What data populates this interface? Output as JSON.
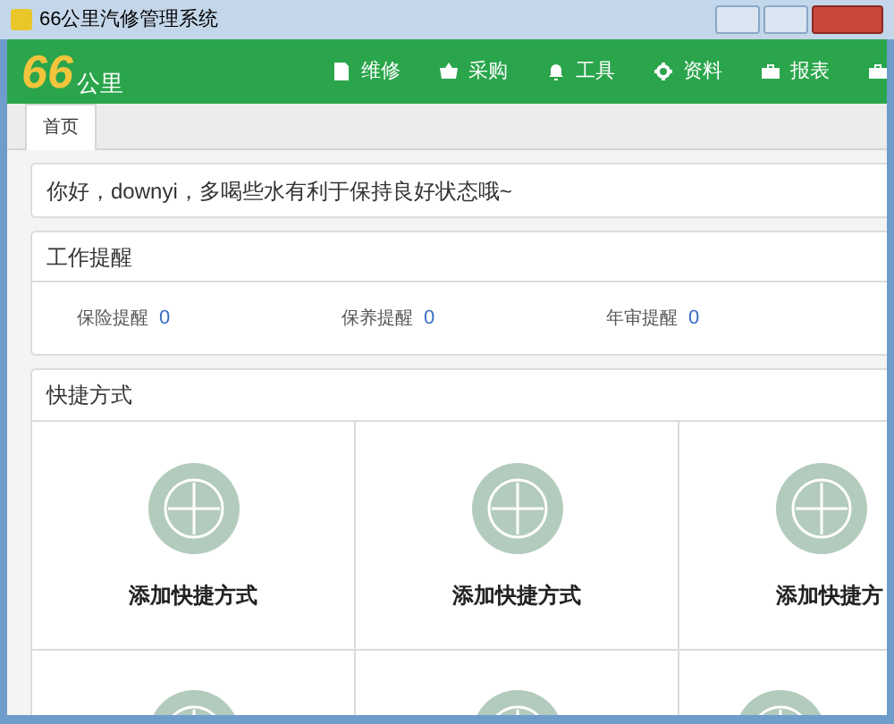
{
  "window": {
    "title": "66公里汽修管理系统"
  },
  "logo": {
    "number": "66",
    "text": "公里"
  },
  "nav": [
    {
      "label": "维修",
      "kind": "doc"
    },
    {
      "label": "采购",
      "kind": "basket"
    },
    {
      "label": "工具",
      "kind": "bell"
    },
    {
      "label": "资料",
      "kind": "gear"
    },
    {
      "label": "报表",
      "kind": "case"
    },
    {
      "kind": "case"
    }
  ],
  "tabs": [
    {
      "label": "首页",
      "selected": true
    }
  ],
  "greeting": "你好，downyi，多喝些水有利于保持良好状态哦~",
  "reminders": {
    "title": "工作提醒",
    "items": [
      {
        "label": "保险提醒",
        "count": "0"
      },
      {
        "label": "保养提醒",
        "count": "0"
      },
      {
        "label": "年审提醒",
        "count": "0"
      }
    ]
  },
  "shortcuts": {
    "title": "快捷方式",
    "items": [
      {
        "label": "添加快捷方式"
      },
      {
        "label": "添加快捷方式"
      },
      {
        "label": "添加快捷方"
      }
    ]
  }
}
